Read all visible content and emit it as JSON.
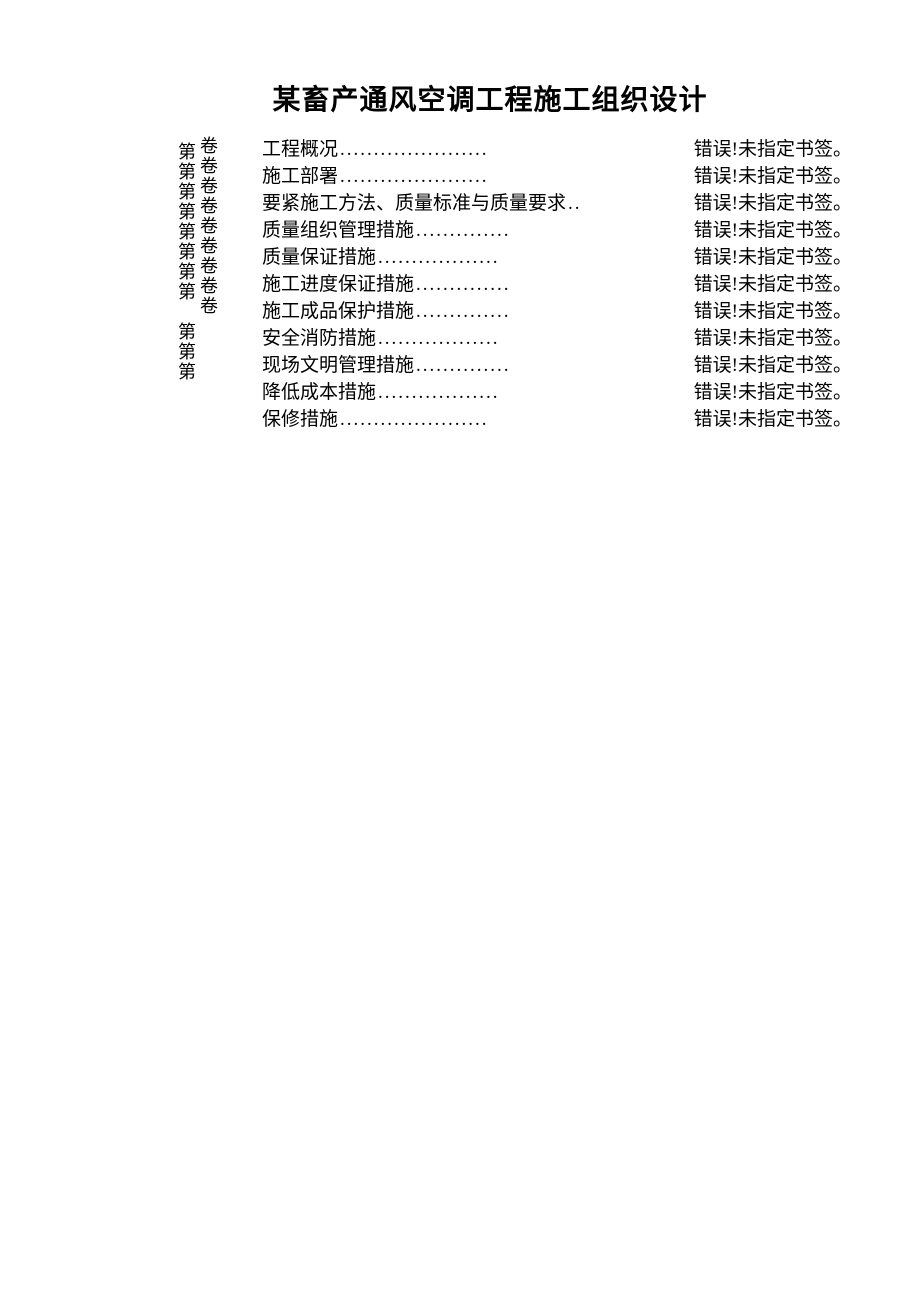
{
  "title": "某畜产通风空调工程施工组织设计",
  "vcol1_chars": [
    "第",
    "第",
    "第",
    "第",
    "第",
    "第",
    "第",
    "第",
    "",
    "第",
    "第",
    "第"
  ],
  "vcol2_chars": [
    "卷",
    "卷",
    "卷",
    "卷",
    "卷",
    "卷",
    "卷",
    "卷",
    "卷"
  ],
  "error_text": "错误!未指定书签。",
  "toc": [
    {
      "label": "工程概况",
      "dots": "......................"
    },
    {
      "label": "施工部署",
      "dots": "......................"
    },
    {
      "label": "要紧施工方法、质量标准与质量要求",
      "dots": ".."
    },
    {
      "label": "质量组织管理措施",
      "dots": ".............."
    },
    {
      "label": "质量保证措施",
      "dots": ".................."
    },
    {
      "label": "施工进度保证措施",
      "dots": ".............."
    },
    {
      "label": "施工成品保护措施",
      "dots": ".............."
    },
    {
      "label": "安全消防措施",
      "dots": ".................."
    },
    {
      "label": "现场文明管理措施",
      "dots": ".............."
    },
    {
      "label": "降低成本措施",
      "dots": ".................."
    },
    {
      "label": "保修措施",
      "dots": "......................"
    }
  ]
}
